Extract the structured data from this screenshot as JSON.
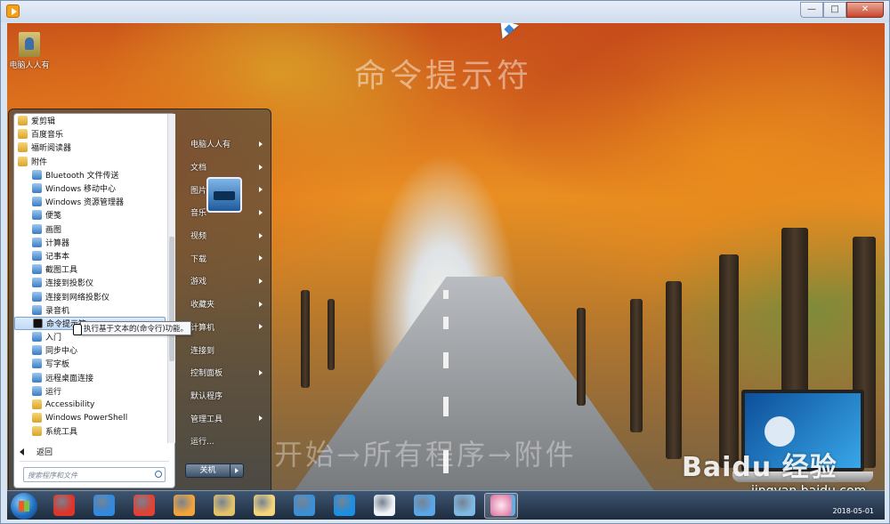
{
  "window": {
    "min_icon": "minimize-icon",
    "max_icon": "maximize-icon",
    "close_icon": "close-icon"
  },
  "desktop": {
    "icon_label": "电脑人人有",
    "watermark_title": "命令提示符",
    "watermark_path": "开始→所有程序→附件"
  },
  "start_menu": {
    "programs": [
      {
        "label": "爱剪辑",
        "icon": "folder-icon",
        "indent": false
      },
      {
        "label": "百度音乐",
        "icon": "folder-icon",
        "indent": false
      },
      {
        "label": "福昕阅读器",
        "icon": "folder-icon",
        "indent": false
      },
      {
        "label": "附件",
        "icon": "folder-icon",
        "indent": false
      },
      {
        "label": "Bluetooth 文件传送",
        "icon": "bluetooth-icon",
        "indent": true
      },
      {
        "label": "Windows 移动中心",
        "icon": "mobility-center-icon",
        "indent": true
      },
      {
        "label": "Windows 资源管理器",
        "icon": "explorer-icon",
        "indent": true
      },
      {
        "label": "便笺",
        "icon": "sticky-notes-icon",
        "indent": true
      },
      {
        "label": "画图",
        "icon": "paint-icon",
        "indent": true
      },
      {
        "label": "计算器",
        "icon": "calculator-icon",
        "indent": true
      },
      {
        "label": "记事本",
        "icon": "notepad-icon",
        "indent": true
      },
      {
        "label": "截图工具",
        "icon": "snipping-tool-icon",
        "indent": true
      },
      {
        "label": "连接到投影仪",
        "icon": "projector-icon",
        "indent": true
      },
      {
        "label": "连接到网络投影仪",
        "icon": "network-projector-icon",
        "indent": true
      },
      {
        "label": "录音机",
        "icon": "sound-recorder-icon",
        "indent": true
      },
      {
        "label": "命令提示符",
        "icon": "command-prompt-icon",
        "indent": true,
        "highlight": true
      },
      {
        "label": "入门",
        "icon": "getting-started-icon",
        "indent": true
      },
      {
        "label": "同步中心",
        "icon": "sync-center-icon",
        "indent": true
      },
      {
        "label": "写字板",
        "icon": "wordpad-icon",
        "indent": true
      },
      {
        "label": "远程桌面连接",
        "icon": "remote-desktop-icon",
        "indent": true
      },
      {
        "label": "运行",
        "icon": "run-icon",
        "indent": true
      },
      {
        "label": "Accessibility",
        "icon": "folder-icon",
        "indent": true
      },
      {
        "label": "Windows PowerShell",
        "icon": "folder-icon",
        "indent": true
      },
      {
        "label": "系统工具",
        "icon": "folder-icon",
        "indent": true
      }
    ],
    "tooltip": "执行基于文本的(命令行)功能。",
    "back_label": "返回",
    "search_placeholder": "搜索程序和文件",
    "right_items": [
      {
        "label": "电脑人人有",
        "submenu": true
      },
      {
        "label": "文档",
        "submenu": true
      },
      {
        "label": "图片",
        "submenu": true
      },
      {
        "label": "音乐",
        "submenu": true
      },
      {
        "label": "视频",
        "submenu": true
      },
      {
        "label": "下载",
        "submenu": true
      },
      {
        "label": "游戏",
        "submenu": true
      },
      {
        "label": "收藏夹",
        "submenu": true
      },
      {
        "label": "计算机",
        "submenu": true
      },
      {
        "label": "连接到",
        "submenu": false
      },
      {
        "label": "控制面板",
        "submenu": true
      },
      {
        "label": "默认程序",
        "submenu": false
      },
      {
        "label": "管理工具",
        "submenu": true
      },
      {
        "label": "运行...",
        "submenu": false
      }
    ],
    "shutdown_label": "关机"
  },
  "overlay": {
    "baidu_logo": "Baidu 经验",
    "baidu_url": "jingyan.baidu.com"
  },
  "taskbar": {
    "date": "2018-05-01",
    "icons": [
      "start-orb-icon",
      "jiang-app-icon",
      "ie-icon",
      "chrome-icon",
      "media-player-icon",
      "explorer-icon",
      "folder-icon",
      "windows-media-center-icon",
      "qq-browser-icon",
      "word-doc-icon",
      "remote-desktop-icon",
      "network-icon",
      "paint-icon",
      "qq-icon"
    ]
  }
}
